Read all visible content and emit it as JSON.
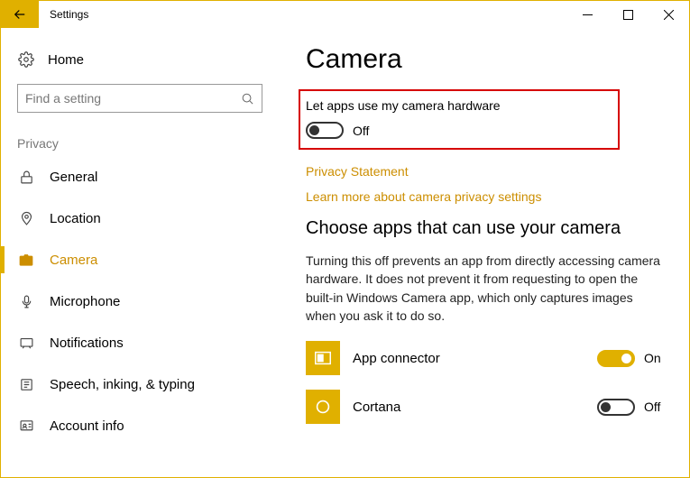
{
  "window": {
    "title": "Settings"
  },
  "sidebar": {
    "home": "Home",
    "search_placeholder": "Find a setting",
    "section": "Privacy",
    "items": [
      {
        "label": "General"
      },
      {
        "label": "Location"
      },
      {
        "label": "Camera"
      },
      {
        "label": "Microphone"
      },
      {
        "label": "Notifications"
      },
      {
        "label": "Speech, inking, & typing"
      },
      {
        "label": "Account info"
      }
    ]
  },
  "main": {
    "title": "Camera",
    "toggle_label": "Let apps use my camera hardware",
    "toggle_state": "Off",
    "link_privacy": "Privacy Statement",
    "link_learn": "Learn more about camera privacy settings",
    "choose_heading": "Choose apps that can use your camera",
    "description": "Turning this off prevents an app from directly accessing camera hardware. It does not prevent it from requesting to open the built-in Windows Camera app, which only captures images when you ask it to do so.",
    "apps": [
      {
        "name": "App connector",
        "state": "On"
      },
      {
        "name": "Cortana",
        "state": "Off"
      }
    ]
  }
}
